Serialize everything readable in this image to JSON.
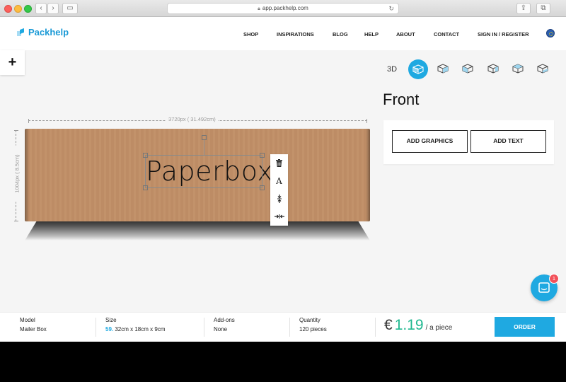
{
  "browser": {
    "url": "app.packhelp.com"
  },
  "site": {
    "logo": "Packhelp",
    "nav": [
      {
        "label": "SHOP",
        "name": "nav-shop"
      },
      {
        "label": "INSPIRATIONS",
        "name": "nav-inspirations"
      },
      {
        "label": "BLOG",
        "name": "nav-blog"
      },
      {
        "label": "HELP",
        "name": "nav-help"
      },
      {
        "label": "ABOUT",
        "name": "nav-about"
      },
      {
        "label": "CONTACT",
        "name": "nav-contact"
      },
      {
        "label": "SIGN IN / REGISTER",
        "name": "nav-sign-in"
      }
    ]
  },
  "editor": {
    "add_symbol": "+",
    "view_label": "3D",
    "width_label": "3720px ( 31.492cm)",
    "height_label": "1004px ( 8.5cm)",
    "design_text": "Paperbox",
    "side_title": "Front",
    "add_graphics": "ADD GRAPHICS",
    "add_text": "ADD TEXT",
    "tools": [
      "delete-icon",
      "font-icon",
      "align-vertical-icon",
      "align-horizontal-icon"
    ],
    "font_tool_glyph": "A"
  },
  "chat": {
    "badge": "1"
  },
  "summary": {
    "model_label": "Model",
    "model_value": "Mailer Box",
    "size_label": "Size",
    "size_code": "59.",
    "size_value": " 32cm x 18cm x 9cm",
    "addons_label": "Add-ons",
    "addons_value": "None",
    "quantity_label": "Quantity",
    "quantity_value": "120 pieces",
    "currency": "€",
    "price": "1.19",
    "per_piece": "/ a piece",
    "order": "ORDER"
  },
  "colors": {
    "accent": "#1fa9e1",
    "price": "#1fb890",
    "box": "#c18f67",
    "badge": "#f2515a"
  }
}
